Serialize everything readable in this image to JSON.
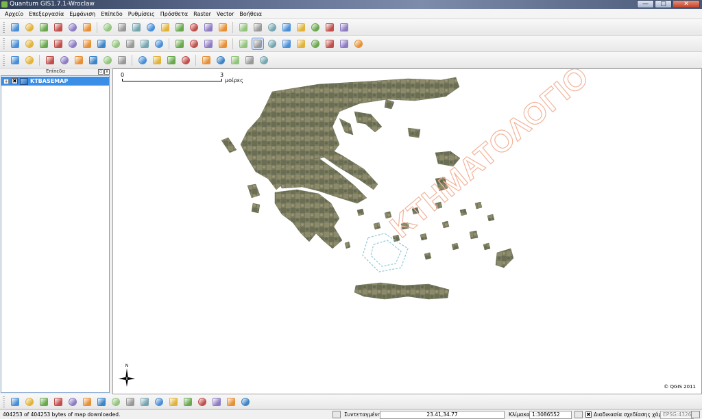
{
  "window": {
    "title": "Quantum GIS1.7.1-Wroclaw",
    "min_label": "—",
    "max_label": "□",
    "close_label": "✕"
  },
  "menu": [
    "Αρχείο",
    "Επεξεργασία",
    "Εμφάνιση",
    "Επίπεδο",
    "Ρυθμίσεις",
    "Πρόσθετα",
    "Raster",
    "Vector",
    "Βοήθεια"
  ],
  "layers_panel": {
    "title": "Επίπεδα",
    "float_btn": "▫",
    "close_btn": "x",
    "layers": [
      {
        "name": "KTBASEMAP",
        "checked": "✖",
        "expand": "+"
      }
    ]
  },
  "map": {
    "scalebar": {
      "start": "0",
      "end": "3",
      "unit": "μοίρες"
    },
    "north_label": "N",
    "watermark": "ΚΤΗΜΑΤΟΛΟΓΙΟ",
    "copyright": "© QGIS 2011"
  },
  "status": {
    "message": "404253 of 404253 bytes of map downloaded.",
    "coord_label": "Συντεταγμένη:",
    "coord_value": "23.41,34.77",
    "scale_label": "Κλίμακα",
    "scale_value": "1:3086552",
    "render_check": "✖",
    "render_label": "Διαδικασία σχεδίασης χάρτη",
    "crs": "EPSG:4326"
  },
  "colors": {
    "selection": "#3a8ee6",
    "watermark": "#f2b49a",
    "watermark_blue": "#8ec9d8"
  },
  "icons": {
    "toolbar1": [
      "new-project-icon",
      "open-project-icon",
      "save-project-icon",
      "save-as-icon",
      "print-composer-icon",
      "print-icon",
      "sep",
      "add-vector-layer-icon",
      "add-raster-layer-icon",
      "add-postgis-icon",
      "add-spatialite-icon",
      "add-wms-icon",
      "new-shapefile-icon",
      "remove-layer-icon",
      "add-wfs-icon",
      "add-oracle-icon",
      "sep",
      "toggle-editing-icon",
      "save-edits-icon",
      "move-feature-icon",
      "node-tool-icon",
      "delete-selected-icon",
      "cut-features-icon",
      "copy-features-icon",
      "paste-features-icon"
    ],
    "toolbar2": [
      "capture-point-icon",
      "capture-line-icon",
      "capture-polygon-icon",
      "add-ring-icon",
      "add-part-icon",
      "delete-ring-icon",
      "delete-part-icon",
      "reshape-icon",
      "split-features-icon",
      "merge-features-icon",
      "merge-attributes-icon",
      "sep",
      "simplify-icon",
      "rotate-point-icon",
      "offset-curve-icon",
      "fill-ring-icon",
      "sep",
      "pan-map-icon",
      "zoom-in-icon",
      "zoom-out-icon",
      "zoom-full-icon",
      "zoom-selection-icon",
      "zoom-layer-icon",
      "zoom-last-icon",
      "zoom-next-icon",
      "refresh-icon"
    ],
    "toolbar3": [
      "undo-icon",
      "redo-icon",
      "sep",
      "rotate-label-icon",
      "move-label-icon",
      "pin-label-icon",
      "show-label-icon",
      "change-label-icon",
      "label-settings-icon",
      "sep",
      "identify-icon",
      "select-icon",
      "deselect-icon",
      "attribute-table-icon",
      "sep",
      "measure-icon",
      "map-tips-icon",
      "bookmark-icon",
      "show-bookmarks-icon",
      "text-annotation-icon"
    ],
    "bottom": [
      "copyright-label-icon",
      "north-arrow-plugin-icon",
      "scale-bar-plugin-icon",
      "gps-icon",
      "georeferencer-icon",
      "grass-icon",
      "globe-icon",
      "raster-terrain-icon",
      "north-arrow-icon",
      "spatial-query-icon",
      "edit-layer-icon",
      "plugin-leaf-icon",
      "dxf-export-icon",
      "delimited-text-icon",
      "python-console-icon",
      "road-graph-icon",
      "oracle-raster-icon"
    ]
  }
}
